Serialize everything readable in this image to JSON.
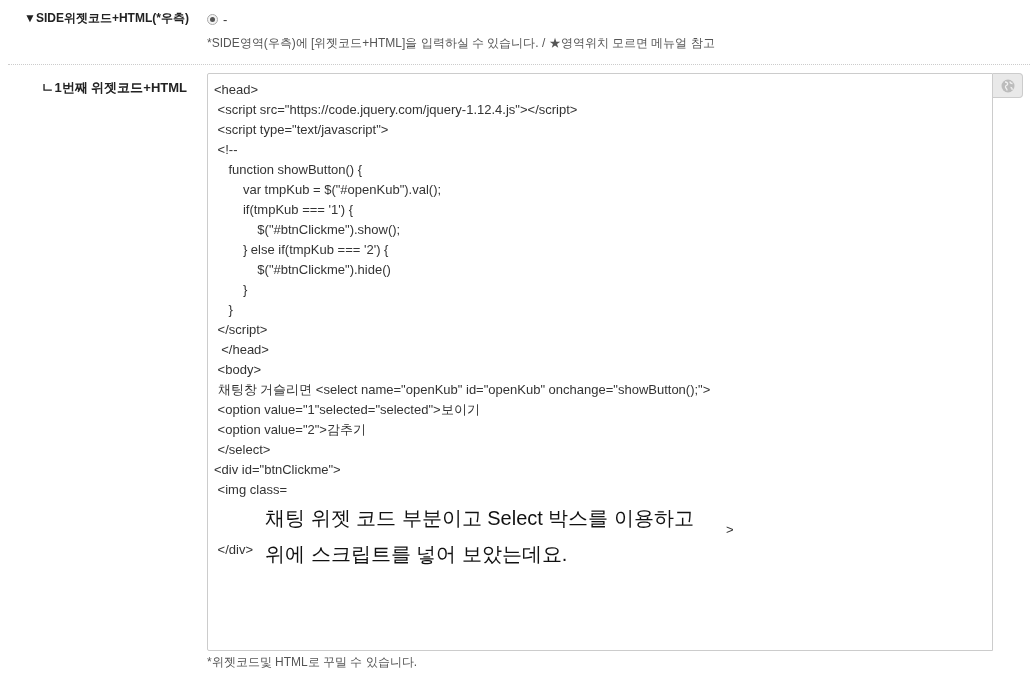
{
  "side_section": {
    "label": "▼SIDE위젯코드+HTML(*우측)",
    "options": [
      {
        "label": "-",
        "selected": true
      }
    ],
    "help": "*SIDE영역(우측)에 [위젯코드+HTML]을 입력하실 수 있습니다. / ★영역위치 모르면 메뉴얼 참고"
  },
  "widget": {
    "label": "ㄴ1번째 위젯코드+HTML",
    "code_lines": [
      {
        "kind": "code",
        "text": "<head>"
      },
      {
        "kind": "code",
        "text": " <script src=\"https://code.jquery.com/jquery-1.12.4.js\"></script>"
      },
      {
        "kind": "code",
        "text": " <script type=\"text/javascript\">"
      },
      {
        "kind": "code",
        "text": " <!--"
      },
      {
        "kind": "code",
        "text": "\tfunction showButton() {"
      },
      {
        "kind": "code",
        "text": "\t\tvar tmpKub = $(\"#openKub\").val();"
      },
      {
        "kind": "code",
        "text": "\t\tif(tmpKub === '1') {"
      },
      {
        "kind": "code",
        "text": "\t\t\t$(\"#btnClickme\").show();"
      },
      {
        "kind": "code",
        "text": "\t\t} else if(tmpKub === '2') {"
      },
      {
        "kind": "code",
        "text": "\t\t\t$(\"#btnClickme\").hide()"
      },
      {
        "kind": "code",
        "text": "\t\t}"
      },
      {
        "kind": "code",
        "text": "\t}"
      },
      {
        "kind": "code",
        "text": " </script>"
      },
      {
        "kind": "code",
        "text": "  </head>"
      },
      {
        "kind": "code",
        "text": " <body>"
      },
      {
        "kind": "code",
        "text": " 채팅창 거슬리면 <select name=\"openKub\" id=\"openKub\" onchange=\"showButton();\">"
      },
      {
        "kind": "code",
        "text": " <option value=\"1\"selected=\"selected\">보이기"
      },
      {
        "kind": "code",
        "text": " <option value=\"2\">감추기"
      },
      {
        "kind": "code",
        "text": " </select>"
      },
      {
        "kind": "code",
        "text": "<div id=\"btnClickme\">"
      },
      {
        "kind": "code",
        "text": " <img class="
      },
      {
        "kind": "tail",
        "text": ">"
      },
      {
        "kind": "code",
        "text": " </div>"
      }
    ],
    "overlay_caption": [
      "채팅 위젯 코드 부분이고 Select 박스를 이용하고",
      "위에 스크립트를 넣어 보았는데요."
    ],
    "help": "*위젯코드및 HTML로 꾸밀 수 있습니다."
  }
}
